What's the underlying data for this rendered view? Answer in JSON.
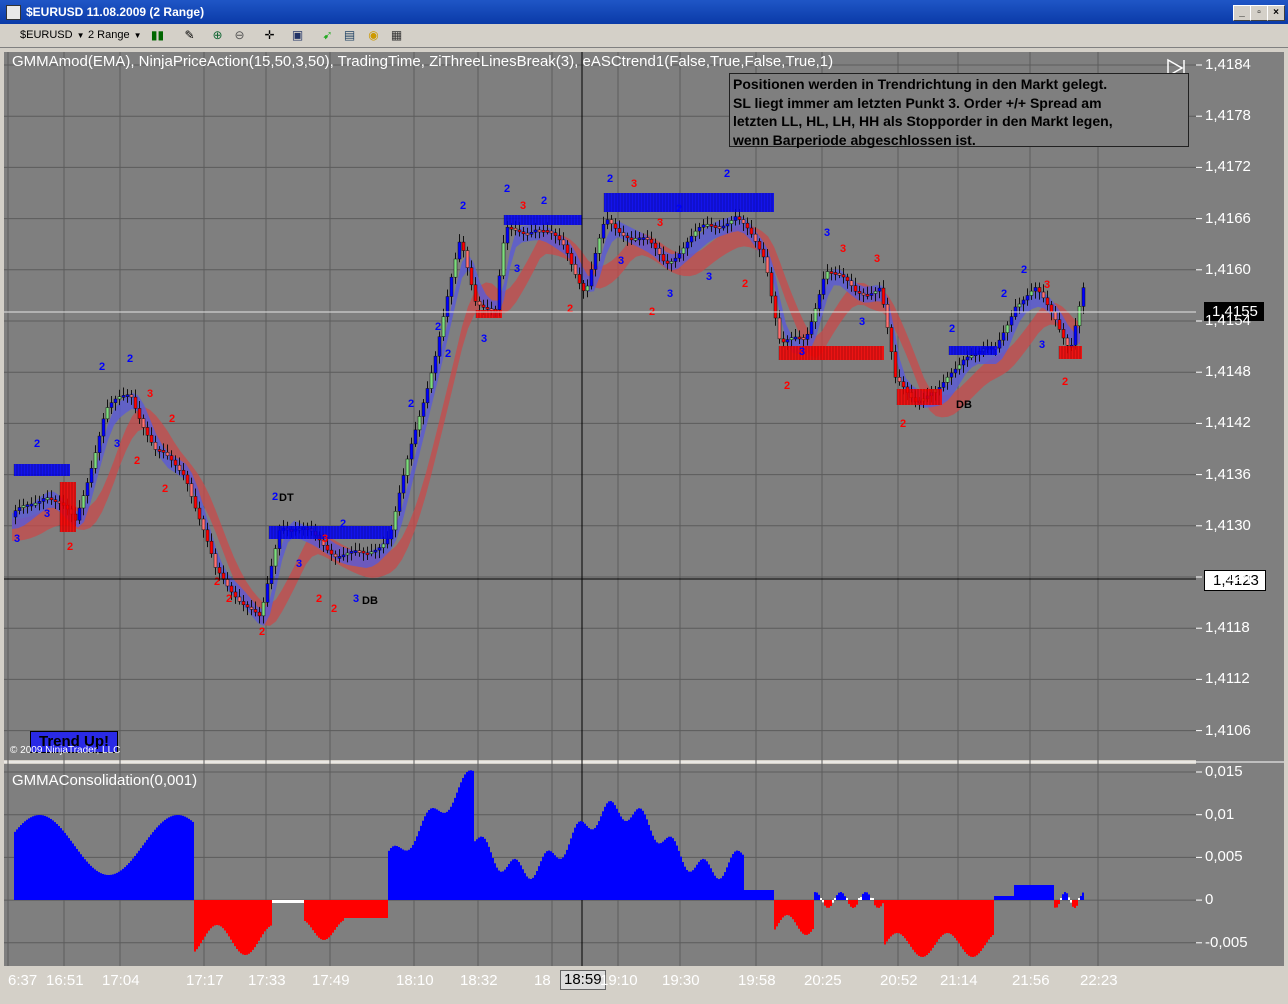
{
  "window": {
    "title": "$EURUSD  11.08.2009 (2 Range)"
  },
  "toolbar": {
    "instrument": "$EURUSD",
    "period": "2 Range"
  },
  "chart": {
    "indicator_label": "GMMAmod(EMA),  NinjaPriceAction(15,50,3,50),  TradingTime,  ZiThreeLinesBreak(3),  eASCtrend1(False,True,False,True,1)",
    "note_lines": [
      "Positionen werden in Trendrichtung in den Markt gelegt.",
      "SL liegt immer am letzten Punkt 3. Order +/+ Spread am",
      "letzten LL, HL, LH, HH als Stopporder in den Markt legen,",
      "wenn Barperiode abgeschlossen ist."
    ],
    "trend_label": "Trend Up!",
    "copyright": "© 2009 NinjaTrader, LLC",
    "price_tag_1": "1,4155",
    "price_tag_2": "1,4123",
    "time_highlight": "18:59",
    "consolidation_label": "GMMAConsolidation(0,001)",
    "price_ticks": [
      "1,4184",
      "1,4178",
      "1,4172",
      "1,4166",
      "1,4160",
      "1,4154",
      "1,4148",
      "1,4142",
      "1,4136",
      "1,4130",
      "1,4124",
      "1,4118",
      "1,4112",
      "1,4106"
    ],
    "osc_ticks": [
      "0,015",
      "0,01",
      "0,005",
      "0",
      "-0,005"
    ],
    "time_ticks": [
      "6:37",
      "16:51",
      "17:04",
      "17:17",
      "17:33",
      "17:49",
      "18:10",
      "18:32",
      "18",
      "19:10",
      "19:30",
      "19:58",
      "20:25",
      "20:52",
      "21:14",
      "21:56",
      "22:23"
    ],
    "pattern_labels": [
      "DT",
      "DB",
      "DB"
    ],
    "colors": {
      "up": "#0000ff",
      "down": "#ff0000",
      "bg": "#7f7f7f",
      "ribbon_red": "#c84a4a",
      "ribbon_blue": "#5a5ad8"
    }
  }
}
